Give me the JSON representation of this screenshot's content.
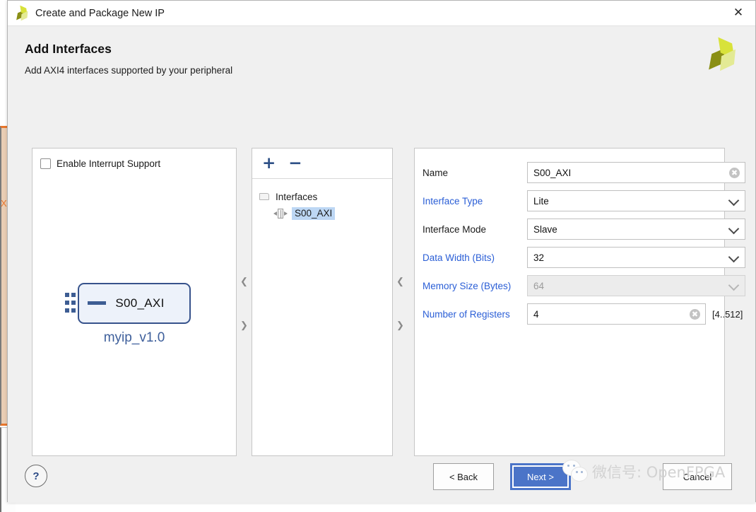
{
  "window": {
    "title": "Create and Package New IP",
    "close_label": "✕",
    "logo_icon": "xilinx-logo-icon"
  },
  "header": {
    "title": "Add Interfaces",
    "subtitle": "Add AXI4 interfaces supported by your peripheral",
    "logo_icon": "xilinx-logo-icon"
  },
  "left_panel": {
    "interrupt_checkbox": {
      "label": "Enable Interrupt Support",
      "checked": false
    },
    "ip_symbol": {
      "port_label": "S00_AXI",
      "module_name": "myip_v1.0"
    }
  },
  "middle_panel": {
    "toolbar": {
      "add_label": "+",
      "remove_label": "−"
    },
    "tree": [
      {
        "label": "Interfaces",
        "icon": "folder-icon",
        "selected": false
      },
      {
        "label": "S00_AXI",
        "icon": "bus-interface-icon",
        "selected": true
      }
    ]
  },
  "right_panel": {
    "fields": [
      {
        "label": "Name",
        "label_color": "black",
        "value": "S00_AXI",
        "control": "text",
        "disabled": false,
        "has_clear": true,
        "hint": ""
      },
      {
        "label": "Interface Type",
        "label_color": "blue",
        "value": "Lite",
        "control": "dropdown",
        "disabled": false,
        "has_clear": false,
        "hint": ""
      },
      {
        "label": "Interface Mode",
        "label_color": "black",
        "value": "Slave",
        "control": "dropdown",
        "disabled": false,
        "has_clear": false,
        "hint": ""
      },
      {
        "label": "Data Width (Bits)",
        "label_color": "blue",
        "value": "32",
        "control": "dropdown",
        "disabled": false,
        "has_clear": false,
        "hint": ""
      },
      {
        "label": "Memory Size (Bytes)",
        "label_color": "blue",
        "value": "64",
        "control": "dropdown",
        "disabled": true,
        "has_clear": false,
        "hint": ""
      },
      {
        "label": "Number of Registers",
        "label_color": "blue",
        "value": "4",
        "control": "text",
        "disabled": false,
        "has_clear": true,
        "hint": "[4..512]"
      }
    ]
  },
  "footer": {
    "help_label": "?",
    "back_label": "< Back",
    "back_key": "B",
    "next_label": "Next >",
    "next_key": "N",
    "cancel_label": "Cancel"
  },
  "watermark": {
    "text": "微信号: OpenFPGA",
    "logo_icon": "wechat-icon"
  },
  "background": {
    "fragment_text": "XI"
  },
  "colors": {
    "accent_blue": "#2a5ed6",
    "default_button_blue": "#4b74c8",
    "selection_blue": "#bdd7f4",
    "ip_block_border": "#37538c",
    "ip_block_fill": "#edf2fa",
    "logo_olive": "#8a8f15",
    "logo_yellow": "#d8e23a",
    "logo_light": "#e3ea94",
    "orange_accent": "#e8762c"
  }
}
